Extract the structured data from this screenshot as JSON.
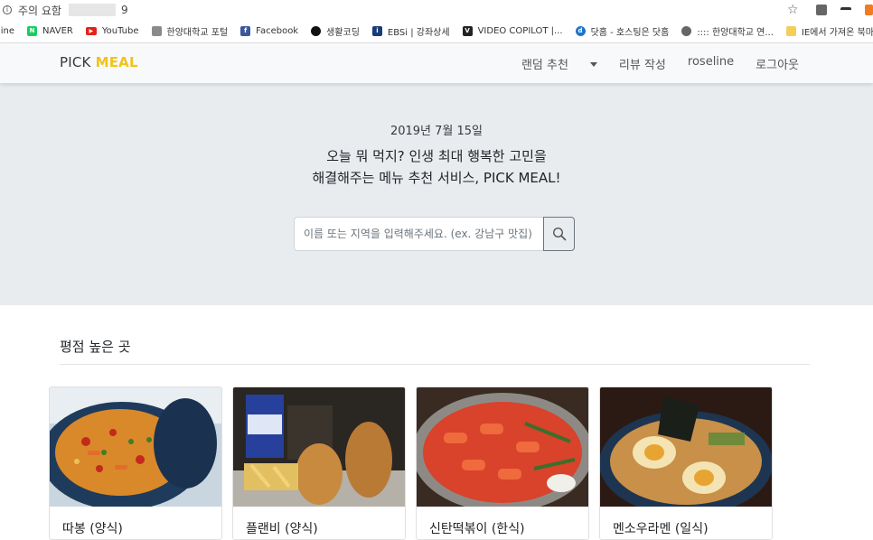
{
  "browser": {
    "warning": "주의 요함",
    "url_tail": "9",
    "bookmarks": [
      {
        "label": "line",
        "icon": "none",
        "color": "#ffffff"
      },
      {
        "label": "NAVER",
        "icon": "naver-icon",
        "color": "#19ce60"
      },
      {
        "label": "YouTube",
        "icon": "youtube-icon",
        "color": "#e62117"
      },
      {
        "label": "한양대학교 포털",
        "icon": "hanyang-icon",
        "color": "#8a8a8a"
      },
      {
        "label": "Facebook",
        "icon": "facebook-icon",
        "color": "#3b5998"
      },
      {
        "label": "생활코딩",
        "icon": "circle-icon",
        "color": "#111111"
      },
      {
        "label": "EBSi | 강좌상세",
        "icon": "ebsi-icon",
        "color": "#1a3b7a"
      },
      {
        "label": "VIDEO COPILOT |...",
        "icon": "videocopilot-icon",
        "color": "#222222"
      },
      {
        "label": "닷홈 - 호스팅은 닷홈",
        "icon": "dothome-icon",
        "color": "#1f74c8"
      },
      {
        "label": ":::: 한양대학교 연...",
        "icon": "globe-icon",
        "color": "#666666"
      },
      {
        "label": "IE에서 가져온 북마크",
        "icon": "folder-icon",
        "color": "#f2cf5b"
      }
    ]
  },
  "navbar": {
    "brand_pick": "PICK",
    "brand_meal": "MEAL",
    "links": {
      "random": "랜덤 추천",
      "review": "리뷰 작성",
      "user": "roseline",
      "logout": "로그아웃"
    }
  },
  "hero": {
    "date": "2019년 7월 15일",
    "line1": "오늘 뭐 먹지? 인생 최대 행복한 고민을",
    "line2": "해결해주는 메뉴 추천 서비스, PICK MEAL!",
    "search_placeholder": "이름 또는 지역을 입력해주세요. (ex. 강남구 맛집)"
  },
  "section": {
    "title": "평점 높은 곳"
  },
  "cards": [
    {
      "title": "따봉 (양식)",
      "image": "paella-photo"
    },
    {
      "title": "플랜비 (양식)",
      "image": "burrito-photo"
    },
    {
      "title": "신탄떡볶이 (한식)",
      "image": "tteokbokki-photo"
    },
    {
      "title": "멘소우라멘 (일식)",
      "image": "ramen-photo"
    }
  ],
  "colors": {
    "brand_accent": "#f0c419",
    "hero_bg": "#e9ecef",
    "navbar_bg": "#f8f9fa"
  }
}
